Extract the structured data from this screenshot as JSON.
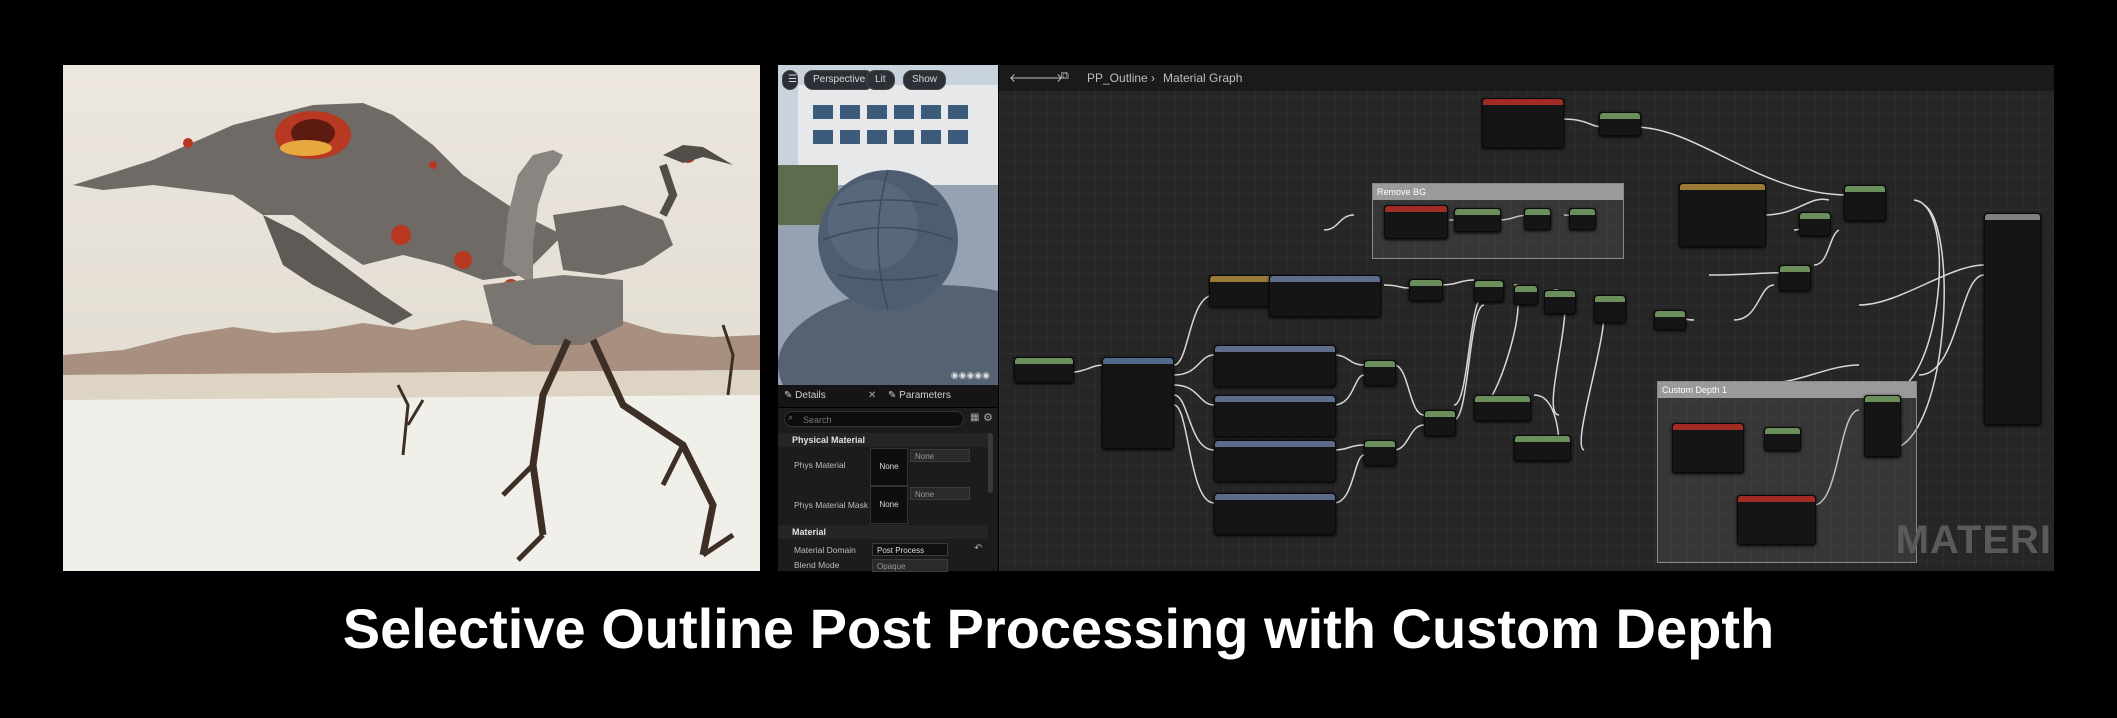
{
  "viewport": {
    "perspective": "Perspective",
    "lit": "Lit",
    "show": "Show"
  },
  "details": {
    "tab_details": "Details",
    "tab_parameters": "Parameters",
    "search_placeholder": "Search",
    "section_physical": "Physical Material",
    "phys_material_label": "Phys Material",
    "phys_material_value": "None",
    "phys_material_combo": "None",
    "phys_mask_label": "Phys Material Mask",
    "phys_mask_value": "None",
    "phys_mask_combo": "None",
    "section_material": "Material",
    "domain_label": "Material Domain",
    "domain_value": "Post Process",
    "blend_label": "Blend Mode",
    "blend_value": "Opaque"
  },
  "graph": {
    "breadcrumb_asset": "PP_Outline",
    "breadcrumb_page": "Material Graph",
    "comment_remove_bg": "Remove BG",
    "comment_custom_depth": "Custom Depth 1",
    "watermark": "MATERI"
  },
  "caption": "Selective Outline Post Processing with Custom Depth"
}
